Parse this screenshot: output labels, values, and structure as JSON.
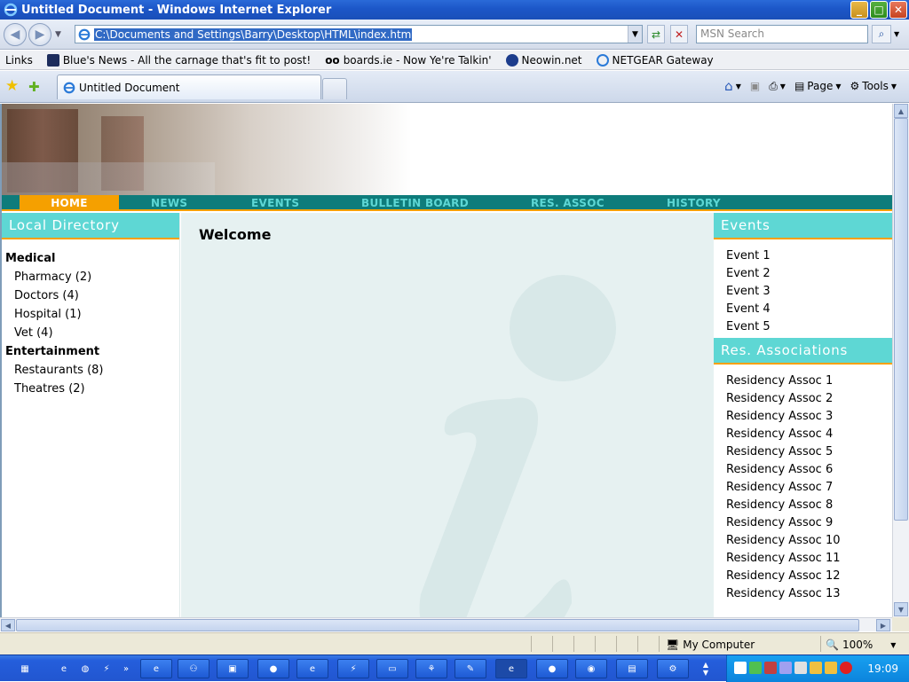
{
  "window": {
    "title": "Untitled Document - Windows Internet Explorer",
    "address": "C:\\Documents and Settings\\Barry\\Desktop\\HTML\\index.htm",
    "search_placeholder": "MSN Search",
    "links_label": "Links",
    "links": [
      "Blue's News - All the carnage that's fit to post!",
      "boards.ie - Now Ye're Talkin'",
      "Neowin.net",
      "NETGEAR Gateway"
    ],
    "tab_title": "Untitled Document",
    "tools": {
      "page": "Page",
      "tools": "Tools"
    }
  },
  "site": {
    "nav": [
      "HOME",
      "NEWS",
      "EVENTS",
      "BULLETIN BOARD",
      "RES. ASSOC",
      "HISTORY"
    ],
    "nav_active": "HOME",
    "left": {
      "title": "Local Directory",
      "categories": [
        {
          "name": "Medical",
          "items": [
            "Pharmacy (2)",
            "Doctors (4)",
            "Hospital (1)",
            "Vet (4)"
          ]
        },
        {
          "name": "Entertainment",
          "items": [
            "Restaurants (8)",
            "Theatres (2)"
          ]
        }
      ]
    },
    "center": {
      "heading": "Welcome"
    },
    "right": {
      "events_title": "Events",
      "events": [
        "Event 1",
        "Event 2",
        "Event 3",
        "Event 4",
        "Event 5"
      ],
      "assoc_title": "Res. Associations",
      "assocs": [
        "Residency Assoc 1",
        "Residency Assoc 2",
        "Residency Assoc 3",
        "Residency Assoc 4",
        "Residency Assoc 5",
        "Residency Assoc 6",
        "Residency Assoc 7",
        "Residency Assoc 8",
        "Residency Assoc 9",
        "Residency Assoc 10",
        "Residency Assoc 11",
        "Residency Assoc 12",
        "Residency Assoc 13"
      ]
    }
  },
  "status": {
    "zone": "My Computer",
    "zoom": "100%"
  },
  "taskbar": {
    "clock": "19:09"
  },
  "colors": {
    "teal_dark": "#0e7c7b",
    "teal_light": "#5ed7d4",
    "orange": "#f5a000",
    "center_bg": "#e6f1f1"
  }
}
